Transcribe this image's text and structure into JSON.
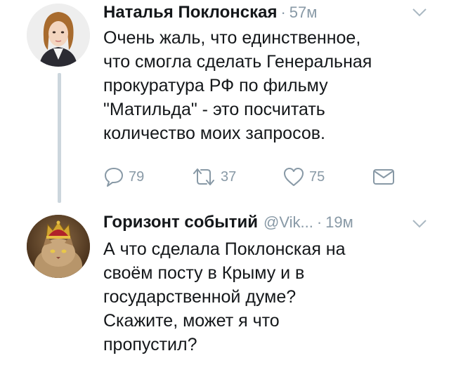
{
  "tweets": [
    {
      "author_name": "Наталья Поклонская",
      "handle": "",
      "time": "57м",
      "text": "Очень жаль, что единственное,\nчто смогла сделать Генеральная\nпрокуратура РФ по фильму\n\"Матильда\" - это посчитать\nколичество моих запросов.",
      "replies": "79",
      "retweets": "37",
      "likes": "75",
      "avatar_icon": "woman-portrait"
    },
    {
      "author_name": "Горизонт событий",
      "handle": "@Vik...",
      "time": "19м",
      "text": "А что сделала Поклонская на\nсвоём посту в Крыму и в\nгосударственной думе?\nСкажите, может я что\nпропустил?",
      "avatar_icon": "crowned-cat-portrait"
    }
  ],
  "colors": {
    "text": "#14171a",
    "muted": "#8899a6",
    "thread_line": "#ccd6dd"
  }
}
